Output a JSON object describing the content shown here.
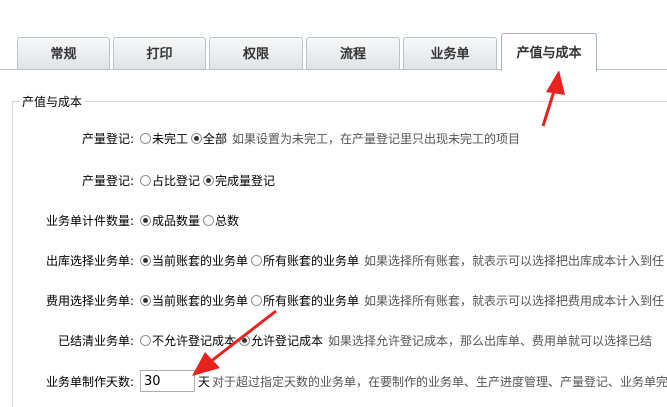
{
  "tabs": [
    {
      "label": "常规"
    },
    {
      "label": "打印"
    },
    {
      "label": "权限"
    },
    {
      "label": "流程"
    },
    {
      "label": "业务单"
    },
    {
      "label": "产值与成本",
      "active": true
    }
  ],
  "section": {
    "title": "产值与成本"
  },
  "rows": [
    {
      "label": "产量登记:",
      "options": [
        "未完工",
        "全部"
      ],
      "selected": 1,
      "hint": "如果设置为未完工，在产量登记里只出现未完工的项目"
    },
    {
      "label": "产量登记:",
      "options": [
        "占比登记",
        "完成量登记"
      ],
      "selected": 1,
      "hint": ""
    },
    {
      "label": "业务单计件数量:",
      "options": [
        "成品数量",
        "总数"
      ],
      "selected": 0,
      "hint": ""
    },
    {
      "label": "出库选择业务单:",
      "options": [
        "当前账套的业务单",
        "所有账套的业务单"
      ],
      "selected": 0,
      "hint": "如果选择所有账套，就表示可以选择把出库成本计入到任"
    },
    {
      "label": "费用选择业务单:",
      "options": [
        "当前账套的业务单",
        "所有账套的业务单"
      ],
      "selected": 0,
      "hint": "如果选择所有账套，就表示可以选择把费用成本计入到任"
    },
    {
      "label": "已结清业务单:",
      "options": [
        "不允许登记成本",
        "允许登记成本"
      ],
      "selected": 1,
      "hint": "如果选择允许登记成本，那么出库单、费用单就可以选择已结"
    }
  ],
  "days": {
    "label": "业务单制作天数:",
    "value": "30",
    "unit": "天",
    "hint": "对于超过指定天数的业务单，在要制作的业务单、生产进度管理、产量登记、业务单完"
  },
  "colors": {
    "arrow": "#e8231e",
    "tab_border": "#b9c3cc"
  },
  "icons": [
    "red-arrow-annotation-icon"
  ]
}
